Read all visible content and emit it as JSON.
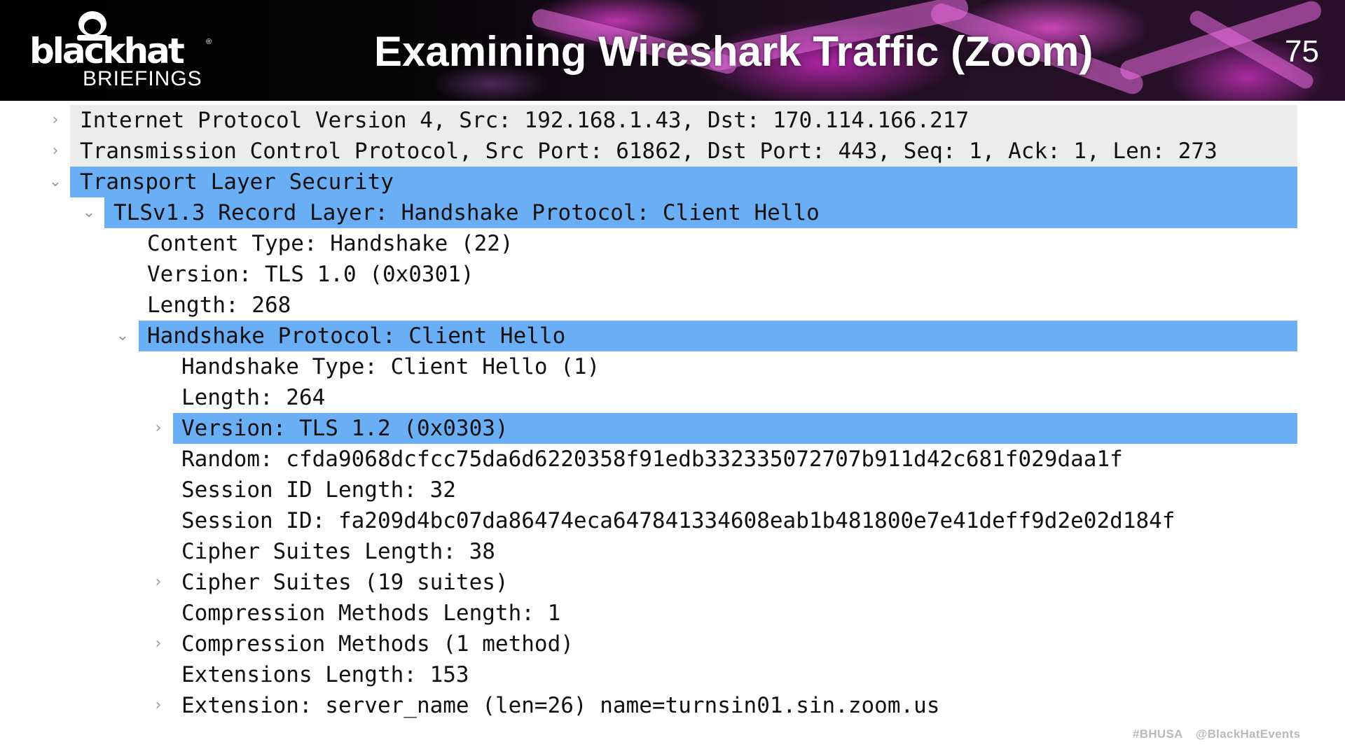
{
  "brand": {
    "name": "blackhat",
    "registered": "®",
    "subtitle": "BRIEFINGS"
  },
  "slide": {
    "title": "Examining Wireshark Traffic (Zoom)",
    "page_number": "75"
  },
  "tree": [
    {
      "text": "Internet Protocol Version 4, Src: 192.168.1.43, Dst: 170.114.166.217",
      "toggle": "›",
      "state": "collapsed",
      "highlight": "gray"
    },
    {
      "text": "Transmission Control Protocol, Src Port: 61862, Dst Port: 443, Seq: 1, Ack: 1, Len: 273",
      "toggle": "›",
      "state": "collapsed",
      "highlight": "gray"
    },
    {
      "text": "Transport Layer Security",
      "toggle": "⌄",
      "state": "expanded",
      "highlight": "selected"
    },
    {
      "text": "TLSv1.3 Record Layer: Handshake Protocol: Client Hello",
      "toggle": "⌄",
      "state": "expanded",
      "highlight": "selected"
    },
    {
      "text": "Content Type: Handshake (22)",
      "toggle": "",
      "state": "leaf",
      "highlight": "none"
    },
    {
      "text": "Version: TLS 1.0 (0x0301)",
      "toggle": "",
      "state": "leaf",
      "highlight": "none"
    },
    {
      "text": "Length: 268",
      "toggle": "",
      "state": "leaf",
      "highlight": "none"
    },
    {
      "text": "Handshake Protocol: Client Hello",
      "toggle": "⌄",
      "state": "expanded",
      "highlight": "selected"
    },
    {
      "text": "Handshake Type: Client Hello (1)",
      "toggle": "",
      "state": "leaf",
      "highlight": "none"
    },
    {
      "text": "Length: 264",
      "toggle": "",
      "state": "leaf",
      "highlight": "none"
    },
    {
      "text": "Version: TLS 1.2 (0x0303)",
      "toggle": "›",
      "state": "collapsed",
      "highlight": "selected"
    },
    {
      "text": "Random: cfda9068dcfcc75da6d6220358f91edb332335072707b911d42c681f029daa1f",
      "toggle": "",
      "state": "leaf",
      "highlight": "none"
    },
    {
      "text": "Session ID Length: 32",
      "toggle": "",
      "state": "leaf",
      "highlight": "none"
    },
    {
      "text": "Session ID: fa209d4bc07da86474eca647841334608eab1b481800e7e41deff9d2e02d184f",
      "toggle": "",
      "state": "leaf",
      "highlight": "none"
    },
    {
      "text": "Cipher Suites Length: 38",
      "toggle": "",
      "state": "leaf",
      "highlight": "none"
    },
    {
      "text": "Cipher Suites (19 suites)",
      "toggle": "›",
      "state": "collapsed",
      "highlight": "none"
    },
    {
      "text": "Compression Methods Length: 1",
      "toggle": "",
      "state": "leaf",
      "highlight": "none"
    },
    {
      "text": "Compression Methods (1 method)",
      "toggle": "›",
      "state": "collapsed",
      "highlight": "none"
    },
    {
      "text": "Extensions Length: 153",
      "toggle": "",
      "state": "leaf",
      "highlight": "none"
    },
    {
      "text": "Extension: server_name (len=26) name=turnsin01.sin.zoom.us",
      "toggle": "›",
      "state": "collapsed",
      "highlight": "none"
    }
  ],
  "footer": {
    "hashtag": "#BHUSA",
    "handle": "@BlackHatEvents"
  },
  "colors": {
    "selected_row": "#6aaef5",
    "gray_row": "#ececec",
    "banner_accent": "#d63cc8",
    "footer_text": "#b9b9b9"
  }
}
